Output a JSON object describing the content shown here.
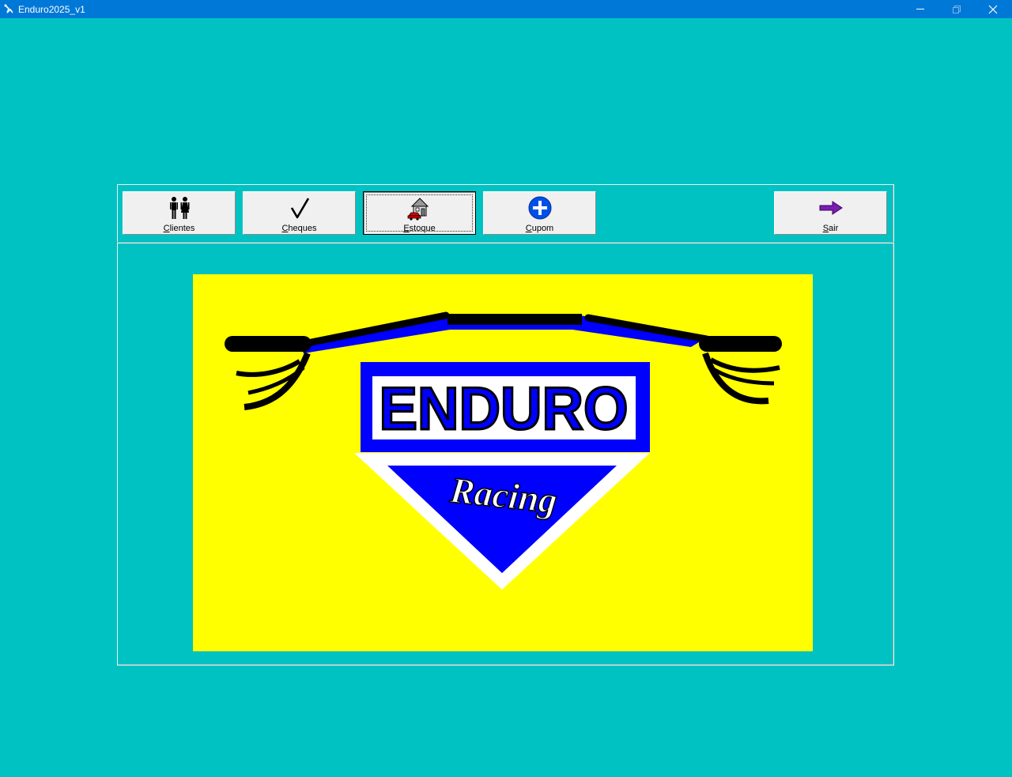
{
  "window": {
    "title": "Enduro2025_v1",
    "controls": [
      "minimize",
      "maximize",
      "close"
    ]
  },
  "toolbar": {
    "buttons": [
      {
        "id": "clientes",
        "label": "Clientes",
        "mnemonic": "C",
        "rest": "lientes",
        "icon": "people-icon"
      },
      {
        "id": "cheques",
        "label": "Cheques",
        "mnemonic": "C",
        "rest": "heques",
        "icon": "checkmark-icon"
      },
      {
        "id": "estoque",
        "label": "Estoque",
        "mnemonic": "E",
        "rest": "stoque",
        "icon": "house-car-icon",
        "pressed": true
      },
      {
        "id": "cupom",
        "label": "Cupom",
        "mnemonic": "C",
        "rest": "upom",
        "icon": "plus-circle-icon"
      },
      {
        "id": "sair",
        "label": "Sair",
        "mnemonic": "S",
        "rest": "air",
        "icon": "arrow-right-icon"
      }
    ]
  },
  "logo": {
    "title_text": "ENDURO",
    "subtitle_text": "Racing",
    "background": "#ffff00",
    "primary_color": "#0000ff"
  },
  "colors": {
    "desktop": "#00c2c2",
    "titlebar": "#0078d7"
  }
}
